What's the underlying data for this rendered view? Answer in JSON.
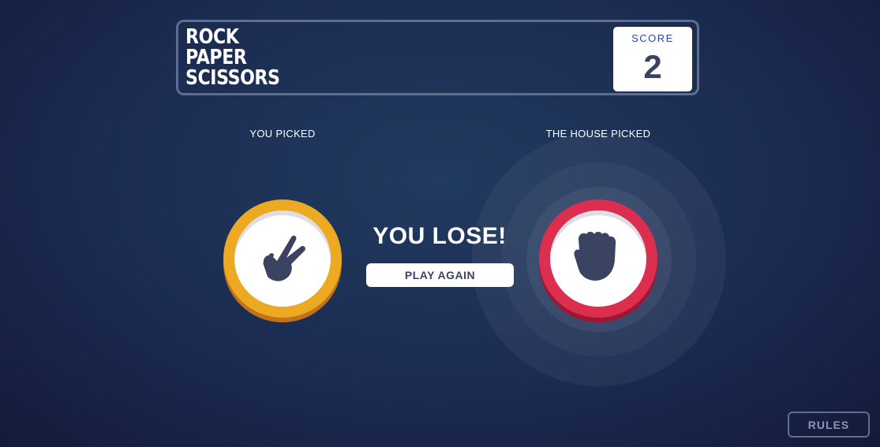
{
  "header": {
    "title_lines": [
      "ROCK",
      "PAPER",
      "SCISSORS"
    ],
    "score_label": "SCORE",
    "score_value": "2"
  },
  "player": {
    "label": "YOU PICKED",
    "choice": "scissors",
    "icon": "scissors-hand-icon",
    "color": "#eca922"
  },
  "house": {
    "label": "THE HOUSE PICKED",
    "choice": "rock",
    "icon": "rock-fist-icon",
    "color": "#dc2e4e"
  },
  "result": {
    "text": "YOU LOSE!",
    "button_label": "PLAY AGAIN"
  },
  "footer": {
    "rules_label": "RULES"
  }
}
